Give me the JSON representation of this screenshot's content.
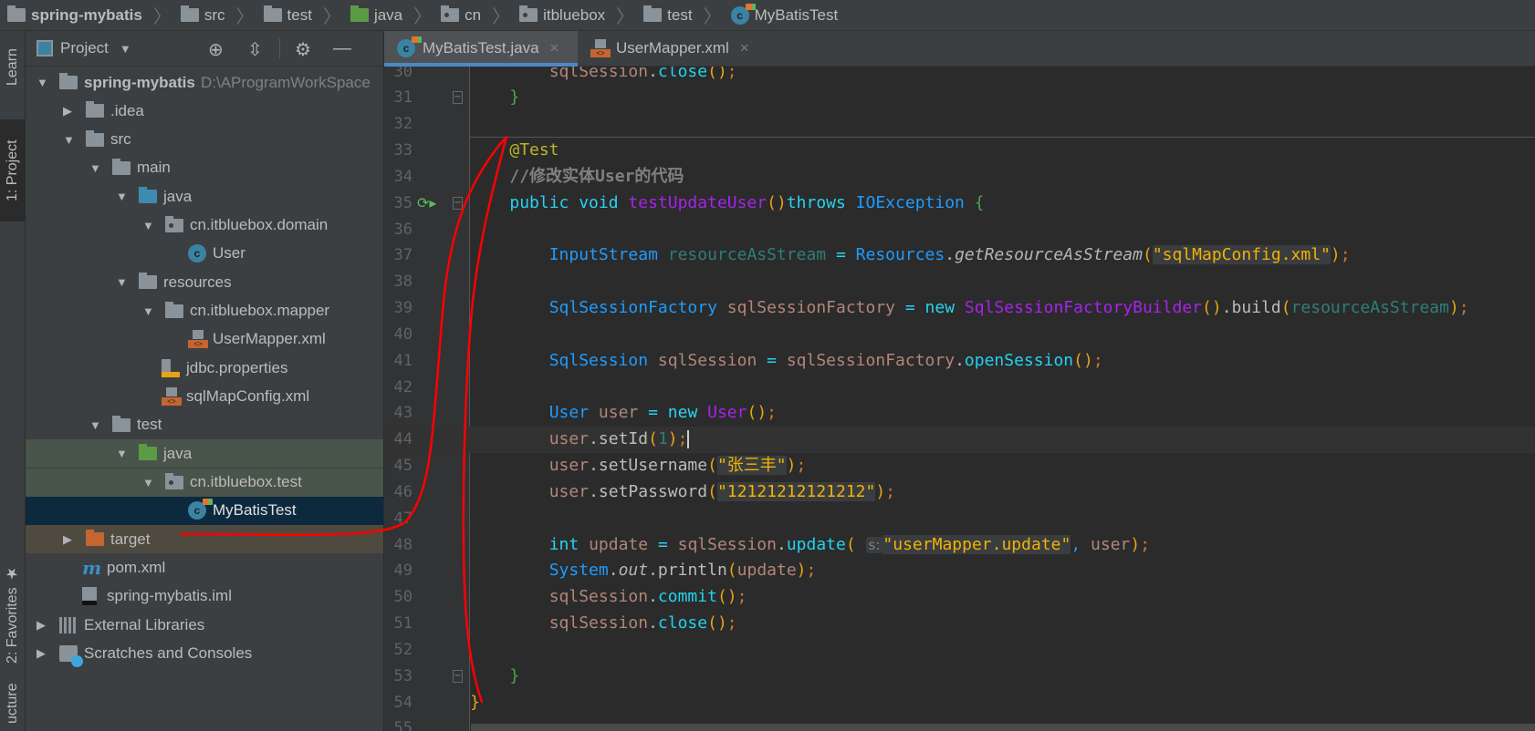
{
  "breadcrumb": [
    {
      "label": "spring-mybatis",
      "icon": "module-icon"
    },
    {
      "label": "src",
      "icon": "folder-icon"
    },
    {
      "label": "test",
      "icon": "folder-icon"
    },
    {
      "label": "java",
      "icon": "test-source-folder-icon"
    },
    {
      "label": "cn",
      "icon": "package-icon"
    },
    {
      "label": "itbluebox",
      "icon": "package-icon"
    },
    {
      "label": "test",
      "icon": "folder-icon"
    },
    {
      "label": "MyBatisTest",
      "icon": "test-class-icon"
    }
  ],
  "toolstrip": {
    "learn": "Learn",
    "project": "1: Project",
    "favorites": "2: Favorites",
    "structure": "ucture"
  },
  "panel": {
    "title": "Project",
    "dropdown": "▼"
  },
  "tree": [
    {
      "label": "spring-mybatis",
      "path": "D:\\AProgramWorkSpace",
      "level": 0,
      "arrow": "down",
      "icon": "module"
    },
    {
      "label": ".idea",
      "level": 1,
      "arrow": "right",
      "icon": "folder"
    },
    {
      "label": "src",
      "level": 1,
      "arrow": "down",
      "icon": "folder"
    },
    {
      "label": "main",
      "level": 2,
      "arrow": "down",
      "icon": "folder"
    },
    {
      "label": "java",
      "level": 3,
      "arrow": "down",
      "icon": "source"
    },
    {
      "label": "cn.itbluebox.domain",
      "level": 4,
      "arrow": "down",
      "icon": "package"
    },
    {
      "label": "User",
      "level": 5,
      "icon": "class"
    },
    {
      "label": "resources",
      "level": 3,
      "arrow": "down",
      "icon": "resources"
    },
    {
      "label": "cn.itbluebox.mapper",
      "level": 4,
      "arrow": "down",
      "icon": "folder"
    },
    {
      "label": "UserMapper.xml",
      "level": 5,
      "icon": "xml"
    },
    {
      "label": "jdbc.properties",
      "level": 4,
      "icon": "properties"
    },
    {
      "label": "sqlMapConfig.xml",
      "level": 4,
      "icon": "xml"
    },
    {
      "label": "test",
      "level": 2,
      "arrow": "down",
      "icon": "folder"
    },
    {
      "label": "java",
      "level": 3,
      "arrow": "down",
      "icon": "testsource",
      "bg": "#49544a"
    },
    {
      "label": "cn.itbluebox.test",
      "level": 4,
      "arrow": "down",
      "icon": "package",
      "bg": "#49544a"
    },
    {
      "label": "MyBatisTest",
      "level": 5,
      "icon": "testclass",
      "bg": "#0d293e",
      "selected": true
    },
    {
      "label": "target",
      "level": 1,
      "arrow": "right",
      "icon": "excluded",
      "bg": "#4f4a3f"
    },
    {
      "label": "pom.xml",
      "level": 1,
      "icon": "maven"
    },
    {
      "label": "spring-mybatis.iml",
      "level": 1,
      "icon": "iml"
    },
    {
      "label": "External Libraries",
      "level": 0,
      "arrow": "right",
      "icon": "libraries"
    },
    {
      "label": "Scratches and Consoles",
      "level": 0,
      "arrow": "right",
      "icon": "scratches"
    }
  ],
  "tabs": [
    {
      "label": "MyBatisTest.java",
      "icon": "test-class-icon",
      "active": true,
      "close": "×"
    },
    {
      "label": "UserMapper.xml",
      "icon": "xml-icon",
      "active": false,
      "close": "×"
    }
  ],
  "editor": {
    "current_line": 44,
    "lines": [
      {
        "n": 30,
        "t": [
          [
            "        ",
            ""
          ],
          [
            "sqlSession",
            "var"
          ],
          [
            ".",
            "pl"
          ],
          [
            "close",
            "m"
          ],
          [
            "()",
            "p"
          ],
          [
            ";",
            "semi"
          ]
        ]
      },
      {
        "n": 31,
        "t": [
          [
            "    ",
            ""
          ],
          [
            "}",
            "br"
          ]
        ]
      },
      {
        "n": 32,
        "t": []
      },
      {
        "n": 33,
        "t": [
          [
            "    ",
            ""
          ],
          [
            "@Test",
            "ann"
          ]
        ]
      },
      {
        "n": 34,
        "t": [
          [
            "    ",
            ""
          ],
          [
            "//修改实体User的代码",
            "cm"
          ]
        ]
      },
      {
        "n": 35,
        "t": [
          [
            "    ",
            ""
          ],
          [
            "public void ",
            "kw"
          ],
          [
            "testUpdateUser",
            "cls"
          ],
          [
            "()",
            "p"
          ],
          [
            "throws ",
            "kw"
          ],
          [
            "IOException ",
            "type"
          ],
          [
            "{",
            "br"
          ]
        ],
        "run": true
      },
      {
        "n": 36,
        "t": []
      },
      {
        "n": 37,
        "t": [
          [
            "        ",
            ""
          ],
          [
            "InputStream ",
            "type"
          ],
          [
            "resourceAsStream ",
            "fld"
          ],
          [
            "= ",
            "kw"
          ],
          [
            "Resources",
            "type"
          ],
          [
            ".",
            "pl"
          ],
          [
            "getResourceAsStream",
            "st"
          ],
          [
            "(",
            "p"
          ],
          [
            "\"sqlMapConfig.xml\"",
            "str"
          ],
          [
            ")",
            "p"
          ],
          [
            ";",
            "semi"
          ]
        ]
      },
      {
        "n": 38,
        "t": []
      },
      {
        "n": 39,
        "t": [
          [
            "        ",
            ""
          ],
          [
            "SqlSessionFactory ",
            "type"
          ],
          [
            "sqlSessionFactory ",
            "var"
          ],
          [
            "= ",
            "kw"
          ],
          [
            "new ",
            "kw"
          ],
          [
            "SqlSessionFactoryBuilder",
            "cls"
          ],
          [
            "()",
            "p"
          ],
          [
            ".build",
            "pl"
          ],
          [
            "(",
            "p"
          ],
          [
            "resourceAsStream",
            "fld"
          ],
          [
            ")",
            "p"
          ],
          [
            ";",
            "semi"
          ]
        ]
      },
      {
        "n": 40,
        "t": []
      },
      {
        "n": 41,
        "t": [
          [
            "        ",
            ""
          ],
          [
            "SqlSession ",
            "type"
          ],
          [
            "sqlSession ",
            "var"
          ],
          [
            "= ",
            "kw"
          ],
          [
            "sqlSessionFactory",
            "var"
          ],
          [
            ".",
            "pl"
          ],
          [
            "openSession",
            "m"
          ],
          [
            "()",
            "p"
          ],
          [
            ";",
            "semi"
          ]
        ]
      },
      {
        "n": 42,
        "t": []
      },
      {
        "n": 43,
        "t": [
          [
            "        ",
            ""
          ],
          [
            "User ",
            "type"
          ],
          [
            "user ",
            "var"
          ],
          [
            "= ",
            "kw"
          ],
          [
            "new ",
            "kw"
          ],
          [
            "User",
            "cls"
          ],
          [
            "()",
            "p"
          ],
          [
            ";",
            "semi"
          ]
        ]
      },
      {
        "n": 44,
        "t": [
          [
            "        ",
            ""
          ],
          [
            "user",
            "var"
          ],
          [
            ".setId",
            "pl"
          ],
          [
            "(",
            "p"
          ],
          [
            "1",
            "fld"
          ],
          [
            ")",
            "p"
          ],
          [
            ";",
            "semi"
          ]
        ],
        "caret": true
      },
      {
        "n": 45,
        "t": [
          [
            "        ",
            ""
          ],
          [
            "user",
            "var"
          ],
          [
            ".setUsername",
            "pl"
          ],
          [
            "(",
            "p"
          ],
          [
            "\"张三丰\"",
            "str"
          ],
          [
            ")",
            "p"
          ],
          [
            ";",
            "semi"
          ]
        ]
      },
      {
        "n": 46,
        "t": [
          [
            "        ",
            ""
          ],
          [
            "user",
            "var"
          ],
          [
            ".setPassword",
            "pl"
          ],
          [
            "(",
            "p"
          ],
          [
            "\"12121212121212\"",
            "str"
          ],
          [
            ")",
            "p"
          ],
          [
            ";",
            "semi"
          ]
        ]
      },
      {
        "n": 47,
        "t": []
      },
      {
        "n": 48,
        "t": [
          [
            "        ",
            ""
          ],
          [
            "int ",
            "kw"
          ],
          [
            "update ",
            "var"
          ],
          [
            "= ",
            "kw"
          ],
          [
            "sqlSession",
            "var"
          ],
          [
            ".",
            "pl"
          ],
          [
            "update",
            "m"
          ],
          [
            "(",
            "p"
          ],
          [
            " ",
            ""
          ],
          [
            "s:",
            "hint"
          ],
          [
            "\"userMapper.update\"",
            "str"
          ],
          [
            ", ",
            "type"
          ],
          [
            "user",
            "var"
          ],
          [
            ")",
            "p"
          ],
          [
            ";",
            "semi"
          ]
        ]
      },
      {
        "n": 49,
        "t": [
          [
            "        ",
            ""
          ],
          [
            "System",
            "type"
          ],
          [
            ".",
            "pl"
          ],
          [
            "out",
            "st"
          ],
          [
            ".println",
            "pl"
          ],
          [
            "(",
            "p"
          ],
          [
            "update",
            "var"
          ],
          [
            ")",
            "p"
          ],
          [
            ";",
            "semi"
          ]
        ]
      },
      {
        "n": 50,
        "t": [
          [
            "        ",
            ""
          ],
          [
            "sqlSession",
            "var"
          ],
          [
            ".",
            "pl"
          ],
          [
            "commit",
            "m"
          ],
          [
            "()",
            "p"
          ],
          [
            ";",
            "semi"
          ]
        ]
      },
      {
        "n": 51,
        "t": [
          [
            "        ",
            ""
          ],
          [
            "sqlSession",
            "var"
          ],
          [
            ".",
            "pl"
          ],
          [
            "close",
            "m"
          ],
          [
            "()",
            "p"
          ],
          [
            ";",
            "semi"
          ]
        ]
      },
      {
        "n": 52,
        "t": []
      },
      {
        "n": 53,
        "t": [
          [
            "    ",
            ""
          ],
          [
            "}",
            "br"
          ]
        ]
      },
      {
        "n": 54,
        "t": [
          [
            "}",
            "p"
          ]
        ]
      },
      {
        "n": 55,
        "t": []
      }
    ]
  },
  "annotation_color": "#ff0000"
}
